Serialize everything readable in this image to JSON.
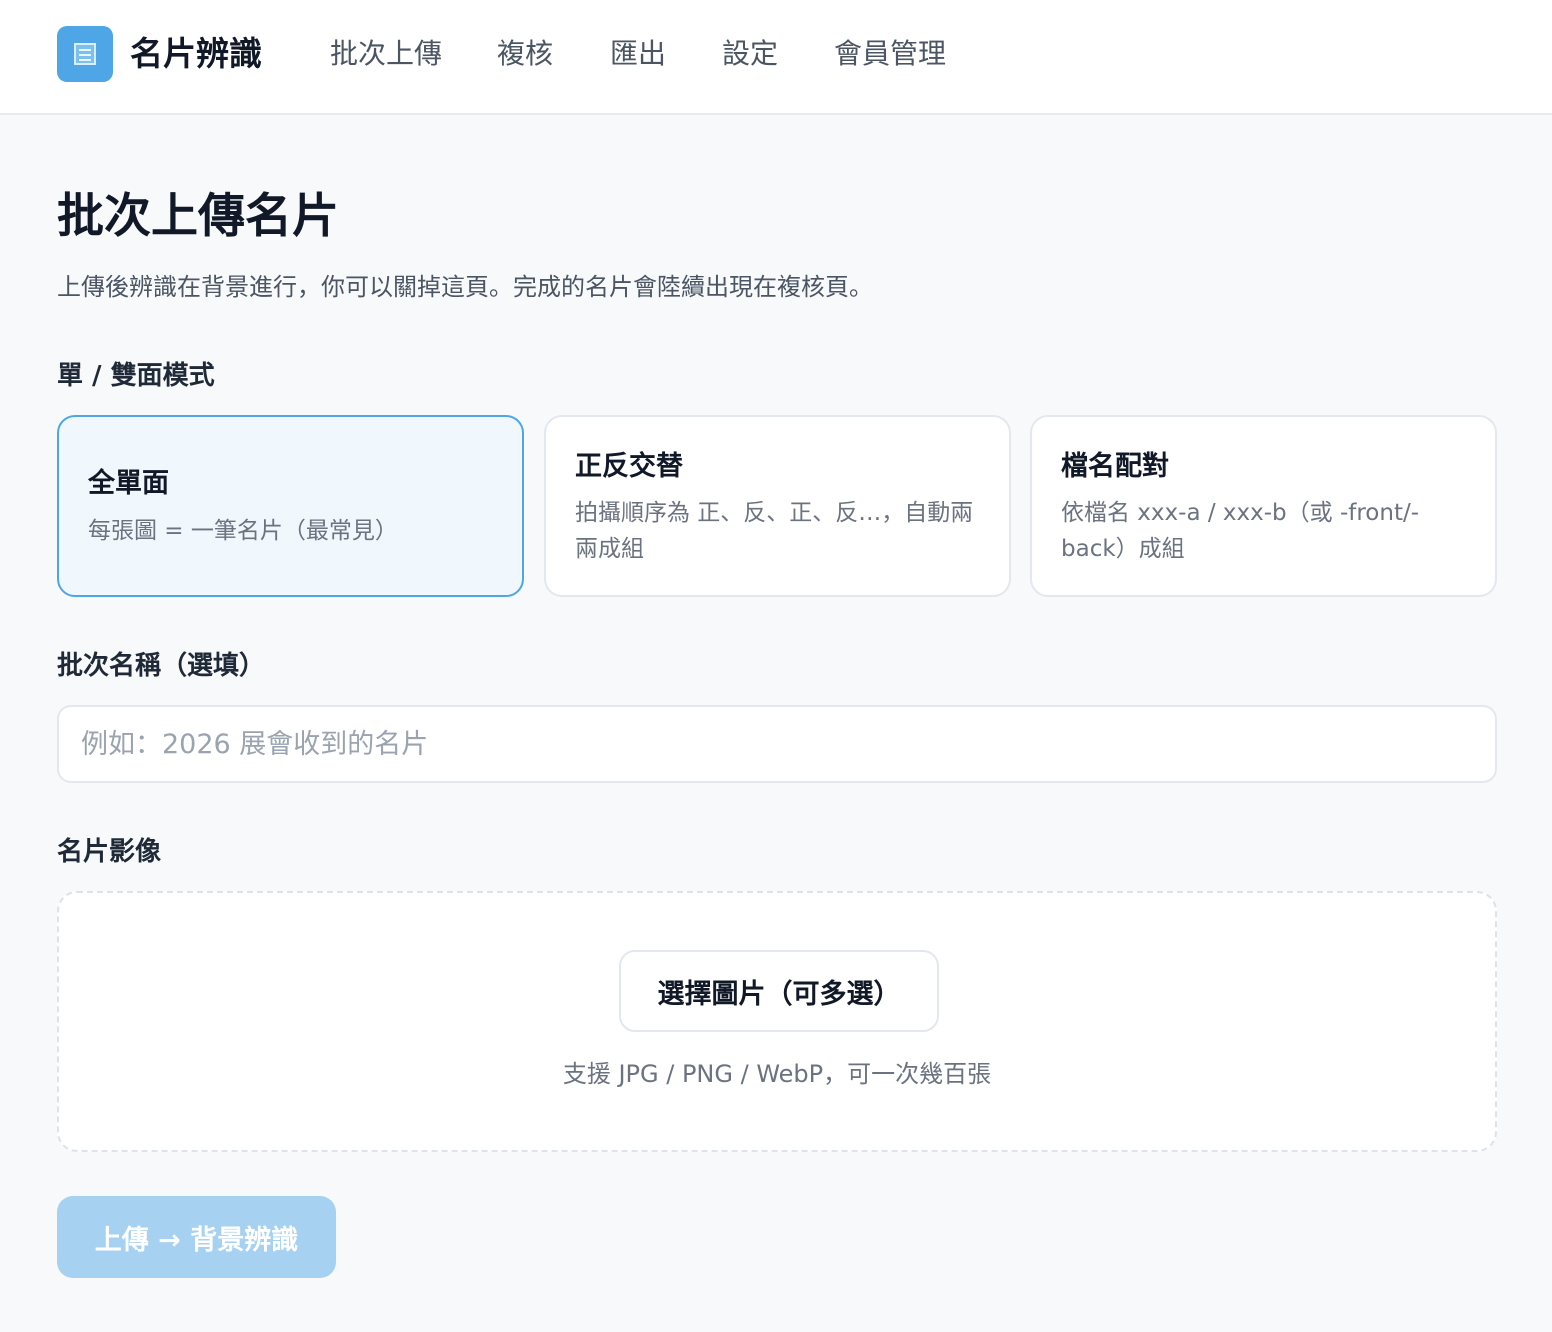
{
  "app": {
    "logo_icon": "card-icon",
    "brand": "名片辨識",
    "accent_color": "#4ea6e6"
  },
  "nav": {
    "items": [
      {
        "label": "批次上傳"
      },
      {
        "label": "複核"
      },
      {
        "label": "匯出"
      },
      {
        "label": "設定"
      },
      {
        "label": "會員管理"
      }
    ]
  },
  "page": {
    "title": "批次上傳名片",
    "subtitle": "上傳後辨識在背景進行，你可以關掉這頁。完成的名片會陸續出現在複核頁。"
  },
  "mode_section": {
    "label": "單 / 雙面模式",
    "selected_index": 0,
    "options": [
      {
        "title": "全單面",
        "desc": "每張圖 = 一筆名片（最常見）"
      },
      {
        "title": "正反交替",
        "desc": "拍攝順序為 正、反、正、反…，自動兩兩成組"
      },
      {
        "title": "檔名配對",
        "desc": "依檔名 xxx-a / xxx-b（或 -front/-back）成組"
      }
    ]
  },
  "batch_name": {
    "label": "批次名稱（選填）",
    "value": "",
    "placeholder": "例如：2026 展會收到的名片"
  },
  "images_section": {
    "label": "名片影像",
    "pick_button": "選擇圖片（可多選）",
    "hint": "支援 JPG / PNG / WebP，可一次幾百張"
  },
  "submit": {
    "label": "上傳 → 背景辨識",
    "disabled": true
  }
}
